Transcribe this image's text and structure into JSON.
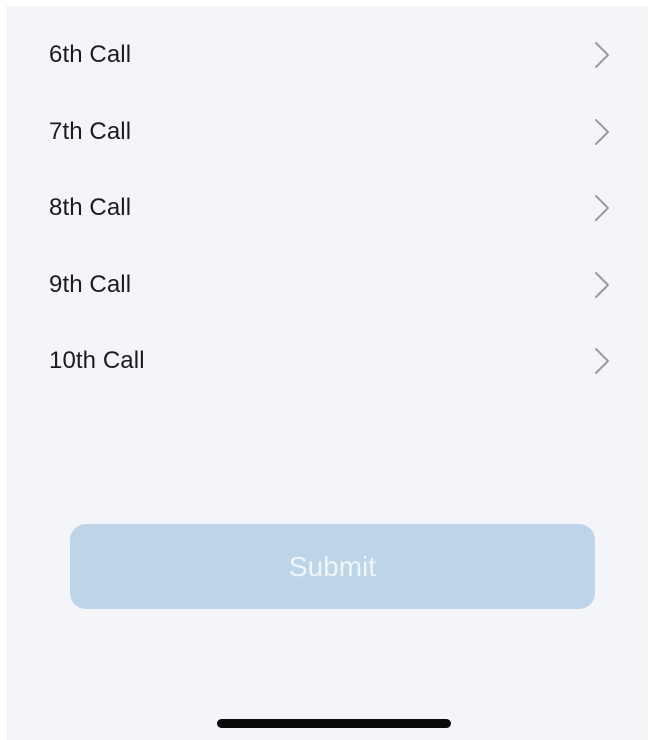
{
  "calls": [
    {
      "label": "6th Call",
      "icon": "chevron-right-icon"
    },
    {
      "label": "7th Call",
      "icon": "chevron-right-icon"
    },
    {
      "label": "8th Call",
      "icon": "chevron-right-icon"
    },
    {
      "label": "9th Call",
      "icon": "chevron-right-icon"
    },
    {
      "label": "10th Call",
      "icon": "chevron-right-icon"
    }
  ],
  "submit": {
    "label": "Submit",
    "enabled": false,
    "color": "#bcd5e9"
  },
  "colors": {
    "background": "#f4f5f9",
    "text": "#1c1c1e",
    "chevron": "#9a9aa0"
  }
}
